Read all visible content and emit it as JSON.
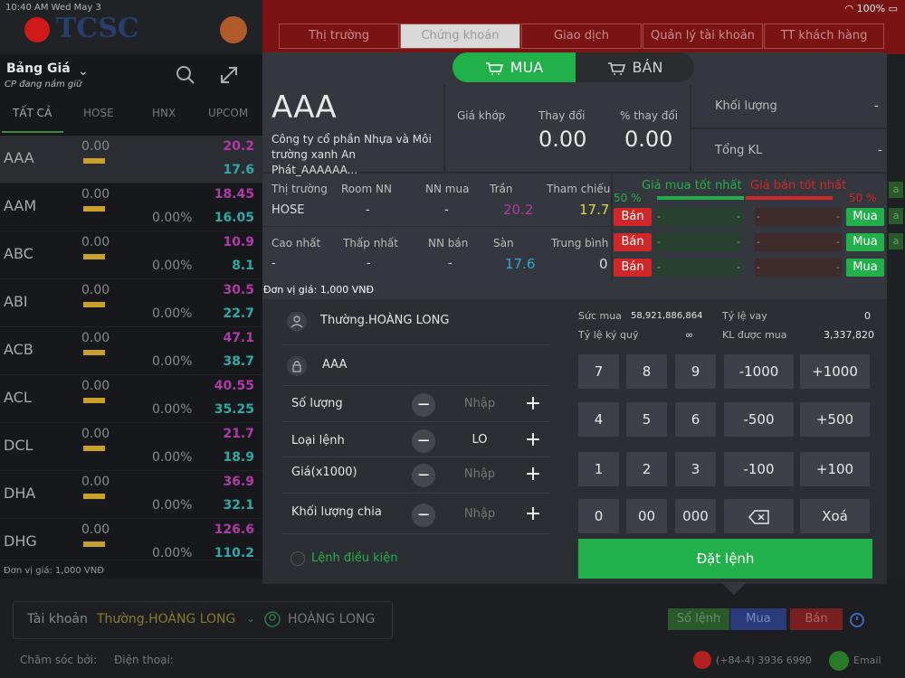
{
  "status": {
    "time": "10:40 AM",
    "day": "Wed May 3",
    "battery": "100%"
  },
  "app": {
    "logo_text": "TCSC"
  },
  "nav": {
    "tabs": [
      "Thị trường",
      "Chứng khoán",
      "Giao dịch",
      "Quản lý tài khoản",
      "TT khách hàng"
    ]
  },
  "watchlist": {
    "title": "Bảng Giá",
    "subtitle": "CP đang nắm giữ",
    "tabs": [
      "TẤT CẢ",
      "HOSE",
      "HNX",
      "UPCOM"
    ],
    "rows": [
      {
        "sym": "AAA",
        "v": "0.00",
        "pct": "",
        "ceil": "20.2",
        "floor": "17.6"
      },
      {
        "sym": "AAM",
        "v": "0.00",
        "pct": "0.00%",
        "ceil": "18.45",
        "floor": "16.05"
      },
      {
        "sym": "ABC",
        "v": "0.00",
        "pct": "0.00%",
        "ceil": "10.9",
        "floor": "8.1"
      },
      {
        "sym": "ABI",
        "v": "0.00",
        "pct": "0.00%",
        "ceil": "30.5",
        "floor": "22.7"
      },
      {
        "sym": "ACB",
        "v": "0.00",
        "pct": "0.00%",
        "ceil": "47.1",
        "floor": "38.7"
      },
      {
        "sym": "ACL",
        "v": "0.00",
        "pct": "0.00%",
        "ceil": "40.55",
        "floor": "35.25"
      },
      {
        "sym": "DCL",
        "v": "0.00",
        "pct": "0.00%",
        "ceil": "21.7",
        "floor": "18.9"
      },
      {
        "sym": "DHA",
        "v": "0.00",
        "pct": "0.00%",
        "ceil": "36.9",
        "floor": "32.1"
      },
      {
        "sym": "DHG",
        "v": "0.00",
        "pct": "0.00%",
        "ceil": "126.6",
        "floor": "110.2"
      }
    ],
    "unit": "Đơn vị giá: 1,000 VNĐ"
  },
  "order": {
    "buy_label": "MUA",
    "sell_label": "BÁN",
    "symbol": "AAA",
    "company": "Công ty cổ phần Nhựa và Môi trường xanh An Phát_AAAAAA...",
    "gia_khop_label": "Giá khớp",
    "thay_doi_label": "Thay đổi",
    "thay_doi": "0.00",
    "pct_label": "% thay đổi",
    "pct": "0.00",
    "khoi_luong_label": "Khối lượng",
    "khoi_luong": "-",
    "tong_kl_label": "Tổng KL",
    "tong_kl": "-",
    "thi_truong_label": "Thị trường",
    "thi_truong": "HOSE",
    "room_label": "Room NN",
    "room": "-",
    "nn_mua_label": "NN mua",
    "nn_mua": "-",
    "tran_label": "Trần",
    "tran": "20.2",
    "tham_chieu_label": "Tham chiếu",
    "tham_chieu": "17.7",
    "cao_label": "Cao nhất",
    "cao": "-",
    "thap_label": "Thấp nhất",
    "thap": "-",
    "nn_ban_label": "NN bán",
    "nn_ban": "-",
    "san_label": "Sàn",
    "san": "17.6",
    "tb_label": "Trung bình",
    "tb": "0",
    "best_buy_label": "Giá mua tốt nhất",
    "best_sell_label": "Giá bán tốt nhất",
    "buy_pct": "50 %",
    "sell_pct": "50 %",
    "ban_btn": "Bán",
    "mua_btn": "Mua",
    "dash": "-",
    "unit": "Đơn vị giá: 1,000 VNĐ",
    "account": "Thường.HOÀNG LONG",
    "stock": "AAA",
    "so_luong_label": "Số lượng",
    "loai_lenh_label": "Loại lệnh",
    "loai_lenh": "LO",
    "gia_label": "Giá(x1000)",
    "klc_label": "Khối lượng chia",
    "placeholder": "Nhập",
    "conditional": "Lệnh điều kiện",
    "suc_mua_label": "Sức mua",
    "suc_mua": "58,921,886,864",
    "ty_le_vay_label": "Tỷ lệ vay",
    "ty_le_vay": "0",
    "ky_quy_label": "Tỷ lệ ký quỹ",
    "ky_quy": "∞",
    "kl_duoc_mua_label": "KL được mua",
    "kl_duoc_mua": "3,337,820",
    "keys": [
      "7",
      "8",
      "9",
      "-1000",
      "+1000",
      "4",
      "5",
      "6",
      "-500",
      "+500",
      "1",
      "2",
      "3",
      "-100",
      "+100",
      "0",
      "00",
      "000",
      "",
      "Xoá"
    ],
    "place": "Đặt lệnh"
  },
  "bottom": {
    "acct_label": "Tài khoản",
    "acct_value": "Thường.HOÀNG LONG",
    "acct_name": "HOÀNG LONG",
    "so_lenh": "Sổ lệnh",
    "mua": "Mua",
    "ban": "Bán",
    "care": "Chăm sóc bởi:",
    "phone": "Điện thoại:",
    "hotline": "(+84-4) 3936 6990",
    "email": "Email"
  },
  "colors": {
    "buy": "#22b04a",
    "sell": "#d02828",
    "ceiling": "#b03aa8",
    "floor": "#2fa8a8",
    "reference": "#e0d84a"
  }
}
